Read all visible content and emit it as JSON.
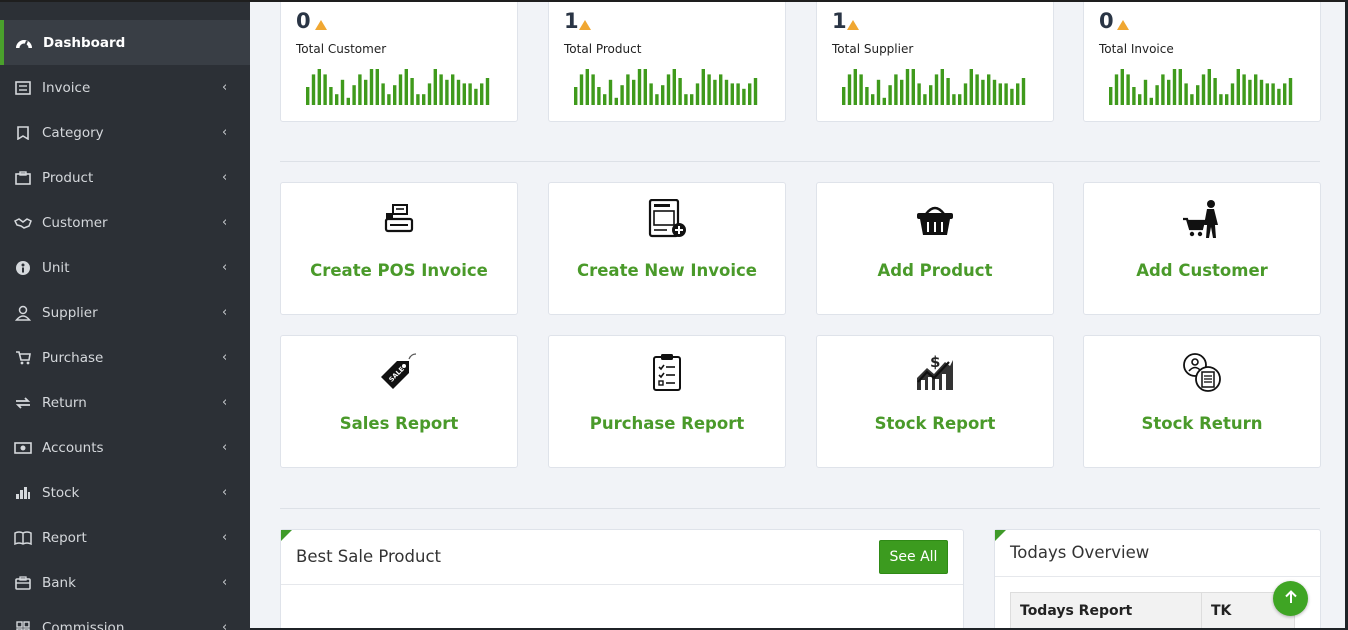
{
  "sidebar": {
    "items": [
      {
        "label": "Dashboard",
        "icon": "dashboard-gauge-icon",
        "active": true
      },
      {
        "label": "Invoice",
        "icon": "invoice-icon"
      },
      {
        "label": "Category",
        "icon": "category-tag-icon"
      },
      {
        "label": "Product",
        "icon": "product-box-icon"
      },
      {
        "label": "Customer",
        "icon": "handshake-icon"
      },
      {
        "label": "Unit",
        "icon": "unit-circle-icon"
      },
      {
        "label": "Supplier",
        "icon": "user-icon"
      },
      {
        "label": "Purchase",
        "icon": "cart-icon"
      },
      {
        "label": "Return",
        "icon": "exchange-icon"
      },
      {
        "label": "Accounts",
        "icon": "money-icon"
      },
      {
        "label": "Stock",
        "icon": "bar-chart-icon"
      },
      {
        "label": "Report",
        "icon": "book-icon"
      },
      {
        "label": "Bank",
        "icon": "bank-icon"
      },
      {
        "label": "Commission",
        "icon": "grid-icon"
      }
    ]
  },
  "stats": [
    {
      "value": "0",
      "label": "Total Customer"
    },
    {
      "value": "1",
      "label": "Total Product"
    },
    {
      "value": "1",
      "label": "Total Supplier"
    },
    {
      "value": "0",
      "label": "Total Invoice"
    }
  ],
  "actions": [
    {
      "label": "Create POS Invoice",
      "icon": "pos-register-icon"
    },
    {
      "label": "Create New Invoice",
      "icon": "new-invoice-icon"
    },
    {
      "label": "Add Product",
      "icon": "basket-icon"
    },
    {
      "label": "Add Customer",
      "icon": "shopper-cart-icon"
    },
    {
      "label": "Sales Report",
      "icon": "sale-tag-icon"
    },
    {
      "label": "Purchase Report",
      "icon": "clipboard-checklist-icon"
    },
    {
      "label": "Stock Report",
      "icon": "stock-growth-icon"
    },
    {
      "label": "Stock Return",
      "icon": "user-document-icon"
    }
  ],
  "best_sale": {
    "title": "Best Sale Product",
    "see_all_label": "See All"
  },
  "todays_overview": {
    "title": "Todays Overview",
    "table_headers": [
      "Todays Report",
      "TK"
    ]
  },
  "colors": {
    "accent": "#4a9a2a",
    "sidebar_bg": "#2c3036",
    "warning": "#f0a732",
    "main_bg": "#f1f3f7"
  }
}
